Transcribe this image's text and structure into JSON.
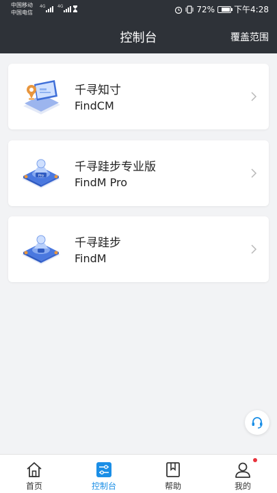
{
  "status_bar": {
    "carrier_1": "中国移动",
    "carrier_2": "中国电信",
    "signal_1_label": "4G",
    "signal_2_label": "4G",
    "battery_percent": "72%",
    "battery_level": 0.72,
    "time": "下午4:28"
  },
  "nav": {
    "title": "控制台",
    "action": "覆盖范围"
  },
  "products": [
    {
      "name": "千寻知寸",
      "subtitle": "FindCM",
      "icon": "laptop-location-icon"
    },
    {
      "name": "千寻跬步专业版",
      "subtitle": "FindM Pro",
      "icon": "pro-station-icon"
    },
    {
      "name": "千寻跬步",
      "subtitle": "FindM",
      "icon": "station-icon"
    }
  ],
  "tabs": [
    {
      "label": "首页",
      "icon": "home-icon",
      "active": false
    },
    {
      "label": "控制台",
      "icon": "console-icon",
      "active": true
    },
    {
      "label": "帮助",
      "icon": "bookmark-icon",
      "active": false
    },
    {
      "label": "我的",
      "icon": "user-icon",
      "active": false,
      "badge": true
    }
  ],
  "colors": {
    "header_bg": "#2e3238",
    "accent": "#1a8ee6",
    "badge": "#e8323c",
    "page_bg": "#f2f3f5"
  }
}
